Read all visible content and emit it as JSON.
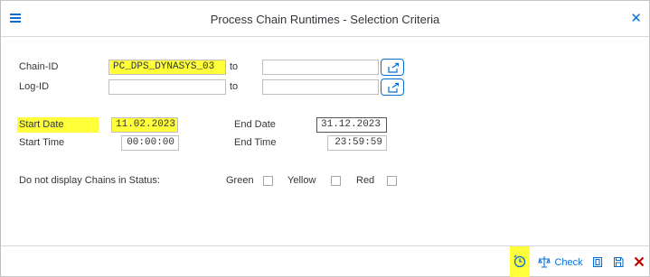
{
  "dialog": {
    "title": "Process Chain Runtimes - Selection Criteria"
  },
  "form": {
    "chain_id": {
      "label": "Chain-ID",
      "value": "PC_DPS_DYNASYS_03",
      "to_label": "to",
      "to_value": ""
    },
    "log_id": {
      "label": "Log-ID",
      "value": "",
      "to_label": "to",
      "to_value": ""
    },
    "start_date": {
      "label": "Start Date",
      "value": "11.02.2023"
    },
    "end_date": {
      "label": "End Date",
      "value": "31.12.2023"
    },
    "start_time": {
      "label": "Start Time",
      "value": "00:00:00"
    },
    "end_time": {
      "label": "End Time",
      "value": "23:59:59"
    },
    "status_filter": {
      "label": "Do not display Chains in Status:",
      "options": [
        {
          "label": "Green",
          "checked": false
        },
        {
          "label": "Yellow",
          "checked": false
        },
        {
          "label": "Red",
          "checked": false
        }
      ]
    }
  },
  "footer": {
    "check_label": "Check",
    "icons": [
      "execute-icon",
      "check-icon",
      "copy-icon",
      "save-icon",
      "cancel-icon"
    ]
  },
  "colors": {
    "accent": "#0a6ed1",
    "highlight": "#ffff3a",
    "cancel": "#bb0000"
  }
}
